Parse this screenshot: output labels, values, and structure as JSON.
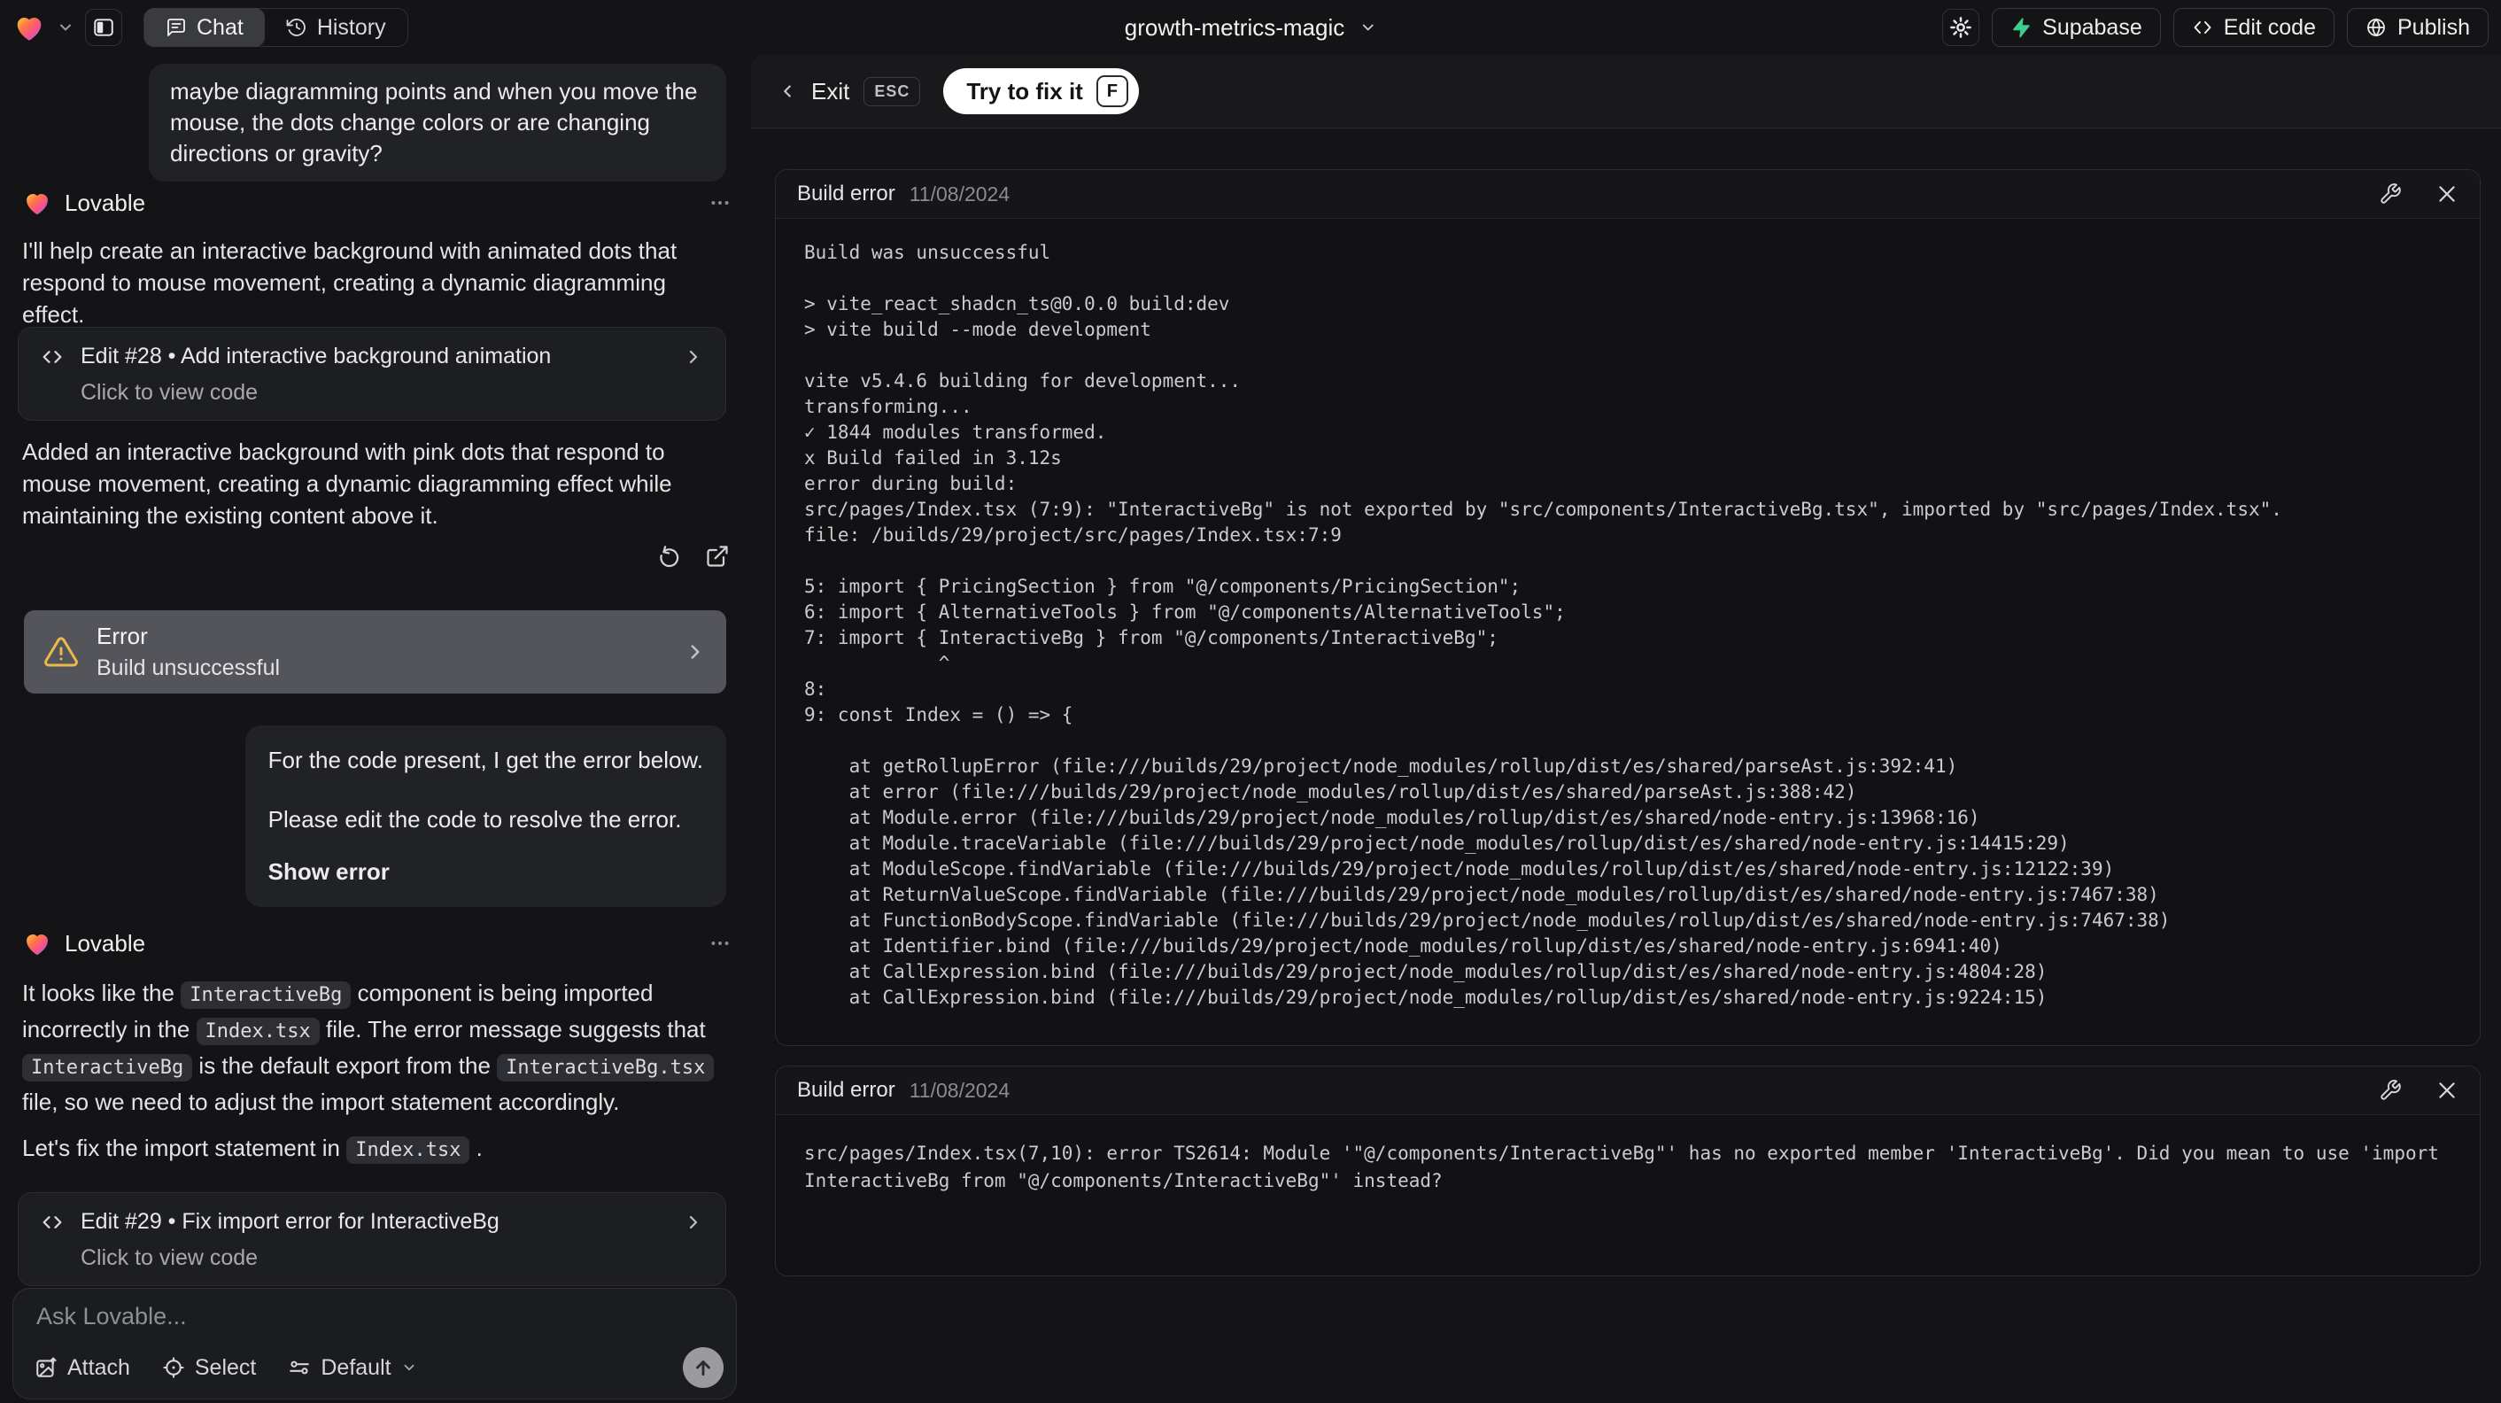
{
  "app": {
    "project_name": "growth-metrics-magic"
  },
  "topbar": {
    "tab_chat": "Chat",
    "tab_history": "History",
    "supabase_label": "Supabase",
    "edit_code_label": "Edit code",
    "publish_label": "Publish"
  },
  "chat": {
    "assistant_name": "Lovable",
    "user_message_1": "maybe diagramming points and when you move the mouse, the dots change colors or are changing directions or gravity?",
    "assistant_intro": "I'll help create an interactive background with animated dots that respond to mouse movement, creating a dynamic diagramming effect.",
    "edit_card_1": {
      "title": "Edit #28 • Add interactive background animation",
      "subtitle": "Click to view code"
    },
    "assistant_summary": "Added an interactive background with pink dots that respond to mouse movement, creating a dynamic diagramming effect while maintaining the existing content above it.",
    "error_card": {
      "title": "Error",
      "subtitle": "Build unsuccessful"
    },
    "user_message_2": {
      "line1": "For the code present, I get the error below.",
      "line2": "Please edit the code to resolve the error.",
      "action": "Show error"
    },
    "fix_explanation": [
      {
        "text": "It looks like the "
      },
      {
        "code": "InteractiveBg"
      },
      {
        "text": " component is being imported incorrectly in the "
      },
      {
        "code": "Index.tsx"
      },
      {
        "text": " file. The error message suggests that "
      },
      {
        "code": "InteractiveBg"
      },
      {
        "text": " is the default export from the "
      },
      {
        "code": "InteractiveBg.tsx"
      },
      {
        "text": " file, so we need to adjust the import statement accordingly."
      }
    ],
    "fix_statement": [
      {
        "text": "Let's fix the import statement in "
      },
      {
        "code": "Index.tsx"
      },
      {
        "text": " ."
      }
    ],
    "edit_card_2": {
      "title": "Edit #29 • Fix import error for InteractiveBg",
      "subtitle": "Click to view code"
    },
    "composer": {
      "placeholder": "Ask Lovable...",
      "attach_label": "Attach",
      "select_label": "Select",
      "mode_label": "Default"
    }
  },
  "overlay": {
    "exit_label": "Exit",
    "exit_shortcut": "ESC",
    "fix_button_label": "Try to fix it",
    "fix_shortcut": "F",
    "panel1": {
      "title": "Build error",
      "date": "11/08/2024",
      "log": "Build was unsuccessful\n\n> vite_react_shadcn_ts@0.0.0 build:dev\n> vite build --mode development\n\nvite v5.4.6 building for development...\ntransforming...\n✓ 1844 modules transformed.\nx Build failed in 3.12s\nerror during build:\nsrc/pages/Index.tsx (7:9): \"InteractiveBg\" is not exported by \"src/components/InteractiveBg.tsx\", imported by \"src/pages/Index.tsx\".\nfile: /builds/29/project/src/pages/Index.tsx:7:9\n\n5: import { PricingSection } from \"@/components/PricingSection\";\n6: import { AlternativeTools } from \"@/components/AlternativeTools\";\n7: import { InteractiveBg } from \"@/components/InteractiveBg\";\n            ^\n8: \n9: const Index = () => {\n\n    at getRollupError (file:///builds/29/project/node_modules/rollup/dist/es/shared/parseAst.js:392:41)\n    at error (file:///builds/29/project/node_modules/rollup/dist/es/shared/parseAst.js:388:42)\n    at Module.error (file:///builds/29/project/node_modules/rollup/dist/es/shared/node-entry.js:13968:16)\n    at Module.traceVariable (file:///builds/29/project/node_modules/rollup/dist/es/shared/node-entry.js:14415:29)\n    at ModuleScope.findVariable (file:///builds/29/project/node_modules/rollup/dist/es/shared/node-entry.js:12122:39)\n    at ReturnValueScope.findVariable (file:///builds/29/project/node_modules/rollup/dist/es/shared/node-entry.js:7467:38)\n    at FunctionBodyScope.findVariable (file:///builds/29/project/node_modules/rollup/dist/es/shared/node-entry.js:7467:38)\n    at Identifier.bind (file:///builds/29/project/node_modules/rollup/dist/es/shared/node-entry.js:6941:40)\n    at CallExpression.bind (file:///builds/29/project/node_modules/rollup/dist/es/shared/node-entry.js:4804:28)\n    at CallExpression.bind (file:///builds/29/project/node_modules/rollup/dist/es/shared/node-entry.js:9224:15)"
    },
    "panel2": {
      "title": "Build error",
      "date": "11/08/2024",
      "log": "src/pages/Index.tsx(7,10): error TS2614: Module '\"@/components/InteractiveBg\"' has no exported member 'InteractiveBg'. Did you mean to use 'import InteractiveBg from \"@/components/InteractiveBg\"' instead?"
    }
  },
  "colors": {
    "warning": "#e9b949",
    "supabase_green": "#3ecf8e",
    "fix_button_bg": "#ffffff",
    "error_card_bg": "#54555b",
    "send_button_bg": "#9b9b9d"
  }
}
